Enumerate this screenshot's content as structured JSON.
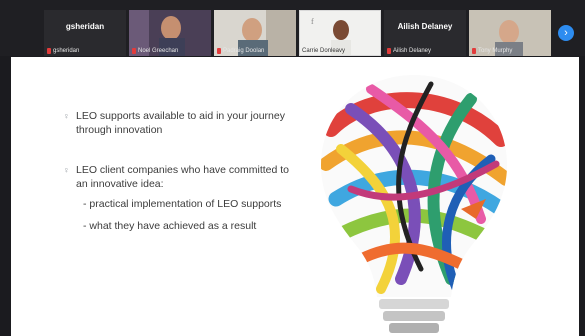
{
  "participants": [
    {
      "name_top": "gsheridan",
      "label": "gsheridan",
      "muted": true
    },
    {
      "name_top": "",
      "label": "Noel Greechan",
      "muted": true
    },
    {
      "name_top": "",
      "label": "Padraig Doolan",
      "muted": true
    },
    {
      "name_top": "",
      "label": "Carrie Donleavy",
      "muted": false
    },
    {
      "name_top": "Ailish Delaney",
      "label": "Ailish Delaney",
      "muted": true
    },
    {
      "name_top": "",
      "label": "Tony Murphy",
      "muted": true
    }
  ],
  "nav": {
    "next_icon": "›"
  },
  "slide": {
    "bullets": [
      {
        "lines": [
          "LEO supports available to aid in your journey",
          "through innovation"
        ]
      },
      {
        "lines": [
          "LEO client companies who have committed to",
          "an innovative idea:"
        ]
      }
    ],
    "subpoints": [
      "- practical implementation of LEO supports",
      "- what they have achieved as a result"
    ]
  },
  "colors": {
    "accent": "#2d8cf0",
    "muted_mic": "#e23b3b"
  },
  "icons": {
    "bullet": "♀"
  }
}
